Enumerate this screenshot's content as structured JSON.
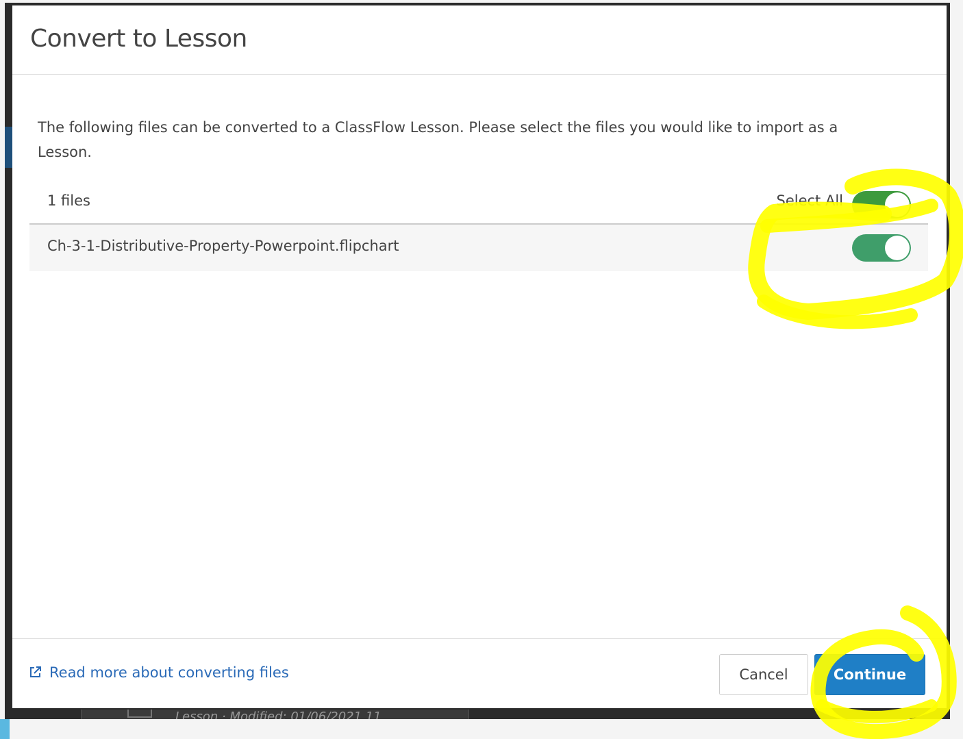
{
  "modal": {
    "title": "Convert to Lesson",
    "intro": "The following files can be converted to a ClassFlow Lesson. Please select the files you would like to import as a Lesson.",
    "files_count": "1 files",
    "select_all_label": "Select All",
    "select_all_on": true,
    "files": [
      {
        "name": "Ch-3-1-Distributive-Property-Powerpoint.flipchart",
        "selected": true
      }
    ]
  },
  "footer": {
    "read_more": "Read more about converting files",
    "cancel": "Cancel",
    "continue": "Continue"
  },
  "background": {
    "lesson_row_text": "Lesson  ·  Modified: 01/06/2021 11"
  },
  "colors": {
    "toggle_on": "#3f9e6a",
    "primary_button": "#1f7fc6",
    "link": "#2a6ab7",
    "highlight": "#ffff00"
  }
}
